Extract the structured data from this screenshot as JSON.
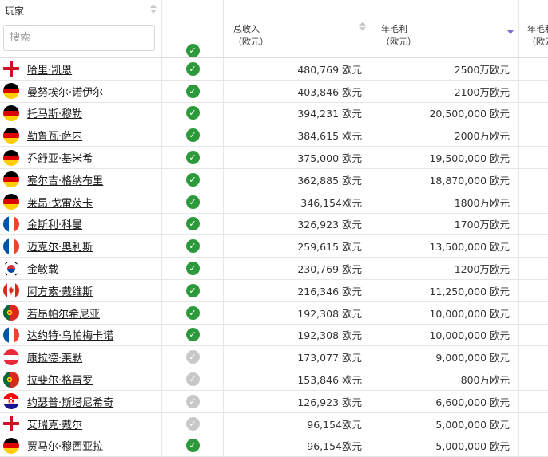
{
  "header": {
    "player_label": "玩家",
    "search_placeholder": "搜索",
    "total_label": "总收入",
    "total_unit": "（欧元）",
    "annual_label": "年毛利",
    "annual_unit": "（欧元）",
    "more_label": "年毛利",
    "more_unit": "（欧元"
  },
  "colors": {
    "check_on": "#2c9a3a",
    "check_off": "#c8c8c8",
    "sort_active": "#7b6fd6"
  },
  "rows": [
    {
      "flag": "england",
      "name": "哈里·凯恩",
      "checked": true,
      "total": "480,769 欧元",
      "annual": "2500万欧元"
    },
    {
      "flag": "germany",
      "name": "曼努埃尔·诺伊尔",
      "checked": true,
      "total": "403,846 欧元",
      "annual": "2100万欧元"
    },
    {
      "flag": "germany",
      "name": "托马斯·穆勒",
      "checked": true,
      "total": "394,231 欧元",
      "annual": "20,500,000 欧元"
    },
    {
      "flag": "germany",
      "name": "勒鲁瓦·萨内",
      "checked": true,
      "total": "384,615 欧元",
      "annual": "2000万欧元"
    },
    {
      "flag": "germany",
      "name": "乔舒亚·基米希",
      "checked": true,
      "total": "375,000 欧元",
      "annual": "19,500,000 欧元"
    },
    {
      "flag": "germany",
      "name": "塞尔吉·格纳布里",
      "checked": true,
      "total": "362,885 欧元",
      "annual": "18,870,000 欧元"
    },
    {
      "flag": "germany",
      "name": "莱昂·戈雷茨卡",
      "checked": true,
      "total": "346,154欧元",
      "annual": "1800万欧元"
    },
    {
      "flag": "france",
      "name": "金斯利·科曼",
      "checked": true,
      "total": "326,923 欧元",
      "annual": "1700万欧元"
    },
    {
      "flag": "france",
      "name": "迈克尔·奥利斯",
      "checked": true,
      "total": "259,615 欧元",
      "annual": "13,500,000 欧元"
    },
    {
      "flag": "korea",
      "name": "金敏载",
      "checked": true,
      "total": "230,769 欧元",
      "annual": "1200万欧元"
    },
    {
      "flag": "canada",
      "name": "阿方索·戴维斯",
      "checked": true,
      "total": "216,346 欧元",
      "annual": "11,250,000 欧元"
    },
    {
      "flag": "portugal",
      "name": "若昂帕尔希尼亚",
      "checked": true,
      "total": "192,308 欧元",
      "annual": "10,000,000 欧元"
    },
    {
      "flag": "france",
      "name": "达约特·乌帕梅卡诺",
      "checked": true,
      "total": "192,308 欧元",
      "annual": "10,000,000 欧元"
    },
    {
      "flag": "austria",
      "name": "康拉德·莱默",
      "checked": false,
      "total": "173,077 欧元",
      "annual": "9,000,000 欧元"
    },
    {
      "flag": "portugal",
      "name": "拉斐尔·格雷罗",
      "checked": false,
      "total": "153,846 欧元",
      "annual": "800万欧元"
    },
    {
      "flag": "croatia",
      "name": "约瑟普·斯塔尼希奇",
      "checked": false,
      "total": "126,923 欧元",
      "annual": "6,600,000 欧元"
    },
    {
      "flag": "england",
      "name": "艾瑞克·戴尔",
      "checked": false,
      "total": "96,154欧元",
      "annual": "5,000,000 欧元"
    },
    {
      "flag": "germany",
      "name": "贾马尔·穆西亚拉",
      "checked": true,
      "total": "96,154欧元",
      "annual": "5,000,000 欧元"
    }
  ]
}
